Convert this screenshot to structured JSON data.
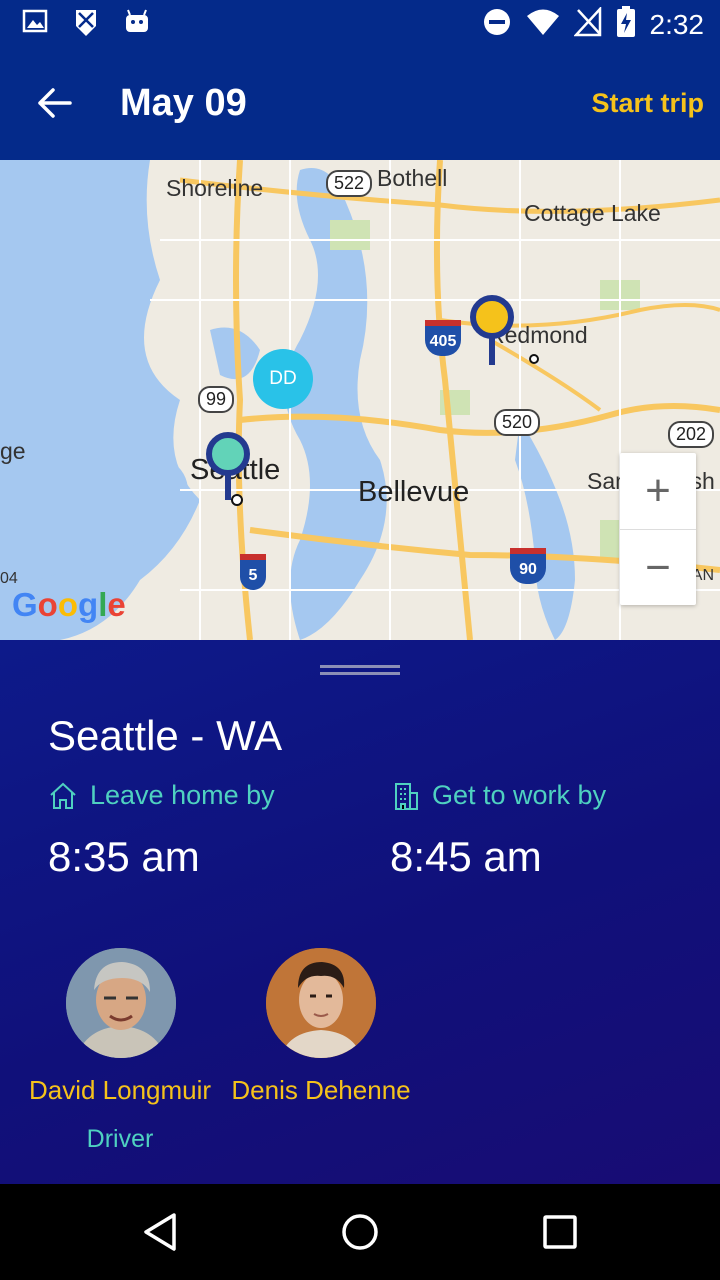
{
  "status_bar": {
    "time": "2:32"
  },
  "app_bar": {
    "title": "May 09",
    "action_label": "Start trip"
  },
  "map": {
    "labels": {
      "shoreline": "Shoreline",
      "bothell": "Bothell",
      "cottage_lake": "Cottage Lake",
      "redmond": "Redmond",
      "seattle": "Seattle",
      "bellevue": "Bellevue",
      "sammamish": "Sammamish",
      "klahanie": "KLAHAN",
      "ge": "ge",
      "left04": "04"
    },
    "shields": {
      "r522": "522",
      "r99": "99",
      "r520": "520",
      "r202": "202",
      "i405": "405",
      "i5": "5",
      "i90": "90"
    },
    "bubble": "DD",
    "provider": "Google",
    "zoom_in": "+",
    "zoom_out": "−"
  },
  "trip": {
    "city": "Seattle - WA",
    "leave_label": "Leave home by",
    "leave_time": "8:35 am",
    "work_label": "Get to work by",
    "work_time": "8:45 am"
  },
  "people": [
    {
      "name": "David Longmuir",
      "role": "Driver"
    },
    {
      "name": "Denis Dehenne",
      "role": ""
    }
  ],
  "colors": {
    "accent": "#f5c21b",
    "teal": "#4fd1c0",
    "appbar": "#042a8a"
  }
}
